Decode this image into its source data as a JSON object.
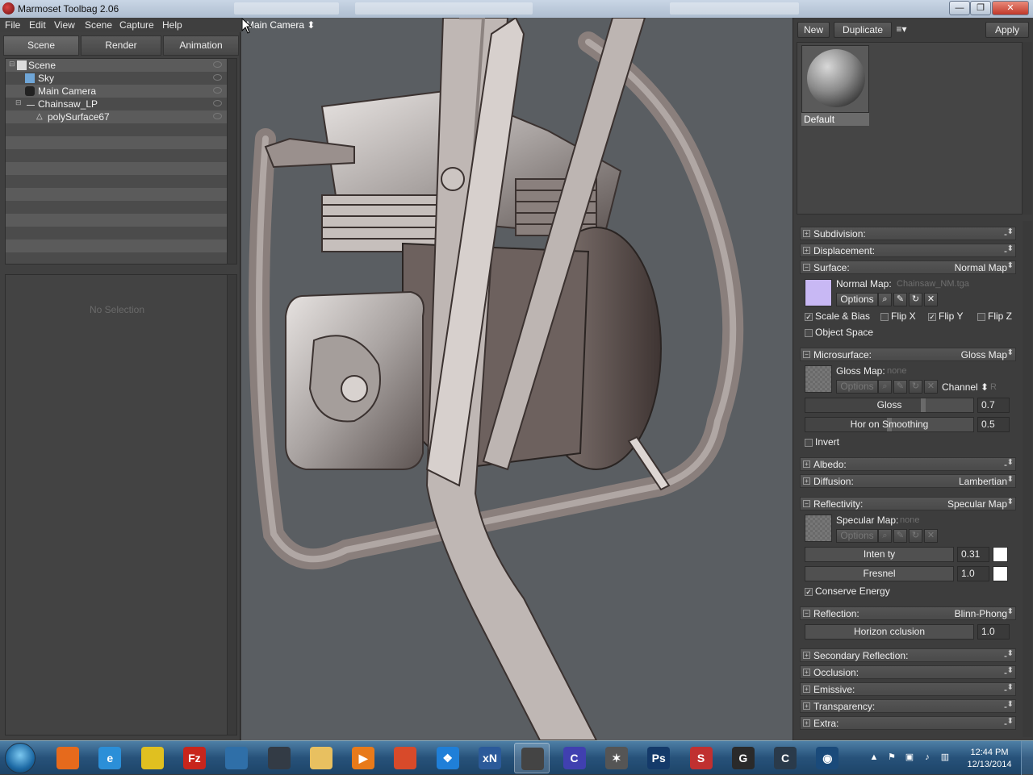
{
  "window": {
    "title": "Marmoset Toolbag 2.06",
    "controls": {
      "minimize": "—",
      "maximize": "❐",
      "close": "✕"
    }
  },
  "menu": [
    "File",
    "Edit",
    "View",
    "Scene",
    "Capture",
    "Help"
  ],
  "left_tabs": [
    "Scene",
    "Render",
    "Animation"
  ],
  "scene_tree": [
    {
      "label": "Scene",
      "icon": "scene-icon"
    },
    {
      "label": "Sky",
      "icon": "sky-icon"
    },
    {
      "label": "Main Camera",
      "icon": "camera-icon"
    },
    {
      "label": "Chainsaw_LP",
      "icon": "group-icon"
    },
    {
      "label": "polySurface67",
      "icon": "mesh-icon"
    }
  ],
  "no_selection": "No Selection",
  "viewport": {
    "camera_label": "Main Camera ⬍"
  },
  "material_toolbar": {
    "new": "New",
    "duplicate": "Duplicate",
    "menu": "≡▾",
    "apply": "Apply"
  },
  "material_name": "Default",
  "sections": {
    "subdivision": {
      "name": "Subdivision:",
      "value": "-"
    },
    "displacement": {
      "name": "Displacement:",
      "value": "-"
    },
    "surface": {
      "name": "Surface:",
      "value": "Normal Map"
    },
    "microsurface": {
      "name": "Microsurface:",
      "value": "Gloss Map"
    },
    "albedo": {
      "name": "Albedo:",
      "value": "-"
    },
    "diffusion": {
      "name": "Diffusion:",
      "value": "Lambertian"
    },
    "reflectivity": {
      "name": "Reflectivity:",
      "value": "Specular Map"
    },
    "reflection": {
      "name": "Reflection:",
      "value": "Blinn-Phong"
    },
    "secondary": {
      "name": "Secondary Reflection:",
      "value": "-"
    },
    "occlusion": {
      "name": "Occlusion:",
      "value": "-"
    },
    "emissive": {
      "name": "Emissive:",
      "value": "-"
    },
    "transparency": {
      "name": "Transparency:",
      "value": "-"
    },
    "extra": {
      "name": "Extra:",
      "value": "-"
    }
  },
  "surface": {
    "normal_map_label": "Normal Map:",
    "normal_map_file": "Chainsaw_NM.tga",
    "options": "Options",
    "scale_bias": "Scale & Bias",
    "flip_x": "Flip X",
    "flip_y": "Flip Y",
    "flip_z": "Flip Z",
    "object_space": "Object Space"
  },
  "microsurface": {
    "gloss_map_label": "Gloss Map:",
    "gloss_map_file": "none",
    "options": "Options",
    "channel_label": "Channel ⬍",
    "channel_value": "R",
    "gloss_label": "Gloss",
    "gloss_value": "0.7",
    "gloss_level": 0.7,
    "horizon_label": "Hor  on Smoothing",
    "horizon_value": "0.5",
    "horizon_level": 0.5,
    "invert": "Invert"
  },
  "reflectivity": {
    "spec_map_label": "Specular Map:",
    "spec_map_file": "none",
    "options": "Options",
    "intensity_label": "Inten  ty",
    "intensity_value": "0.31",
    "fresnel_label": "Fresnel",
    "fresnel_value": "1.0",
    "conserve": "Conserve Energy"
  },
  "reflection": {
    "horizon_label": "Horizon  cclusion",
    "horizon_value": "1.0"
  },
  "taskbar": {
    "apps": [
      {
        "name": "firefox",
        "glyph": "",
        "color": "#e66a1c"
      },
      {
        "name": "internet-explorer",
        "glyph": "e",
        "color": "#2b8fd8"
      },
      {
        "name": "chrome",
        "glyph": "",
        "color": "#e0c020"
      },
      {
        "name": "filezilla",
        "glyph": "Fz",
        "color": "#c8251c"
      },
      {
        "name": "search-tool",
        "glyph": "",
        "color": "#2f6fa8"
      },
      {
        "name": "alien-app",
        "glyph": "",
        "color": "#333b45"
      },
      {
        "name": "file-explorer",
        "glyph": "",
        "color": "#e8c060"
      },
      {
        "name": "media-player",
        "glyph": "▶",
        "color": "#e87a1a"
      },
      {
        "name": "crossover",
        "glyph": "",
        "color": "#d84a2a"
      },
      {
        "name": "dropbox",
        "glyph": "❖",
        "color": "#1f7fd8"
      },
      {
        "name": "xnormal",
        "glyph": "xN",
        "color": "#2b5a9a"
      },
      {
        "name": "marmoset",
        "glyph": "",
        "color": "#444"
      },
      {
        "name": "crazybump",
        "glyph": "C",
        "color": "#4040b0"
      },
      {
        "name": "zbrush",
        "glyph": "✶",
        "color": "#555"
      },
      {
        "name": "photoshop",
        "glyph": "Ps",
        "color": "#143a6a"
      },
      {
        "name": "substance",
        "glyph": "S",
        "color": "#c03030"
      },
      {
        "name": "ndo",
        "glyph": "G",
        "color": "#2a2a2a"
      },
      {
        "name": "c-app",
        "glyph": "C",
        "color": "#2a3a4a"
      },
      {
        "name": "aperture",
        "glyph": "◉",
        "color": "#1a4a7a"
      }
    ],
    "time": "12:44 PM",
    "date": "12/13/2014"
  }
}
